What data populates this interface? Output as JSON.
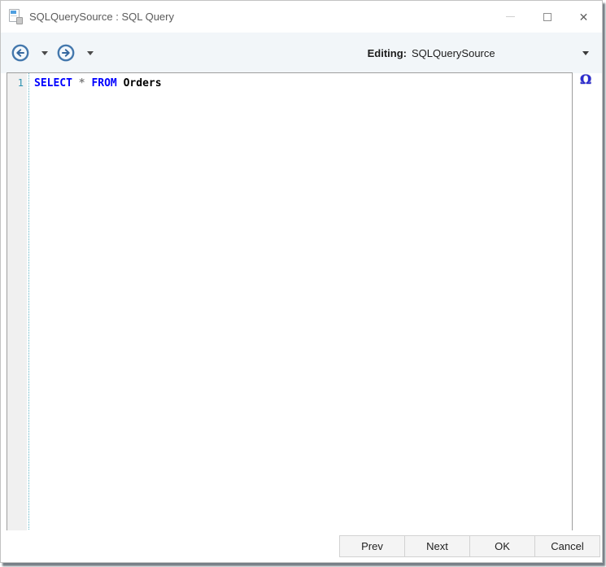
{
  "window": {
    "title": "SQLQuerySource : SQL Query",
    "controls": {
      "close_glyph": "✕"
    }
  },
  "toolbar": {
    "editing_label": "Editing:",
    "editing_value": "SQLQuerySource"
  },
  "editor": {
    "lines": [
      {
        "number": "1",
        "tokens": [
          {
            "text": "SELECT",
            "type": "keyword"
          },
          {
            "text": " ",
            "type": "plain"
          },
          {
            "text": "*",
            "type": "operator"
          },
          {
            "text": " ",
            "type": "plain"
          },
          {
            "text": "FROM",
            "type": "keyword"
          },
          {
            "text": " Orders",
            "type": "plain"
          }
        ]
      }
    ],
    "symbol_glyph": "Ω"
  },
  "footer": {
    "buttons": [
      {
        "label": "Prev"
      },
      {
        "label": "Next"
      },
      {
        "label": "OK"
      },
      {
        "label": "Cancel"
      }
    ]
  },
  "icons": {
    "document": "document-icon",
    "back": "back-arrow-circle-icon",
    "forward": "forward-arrow-circle-icon",
    "dropdown": "chevron-down-icon",
    "minimize": "minimize-icon",
    "maximize": "maximize-icon",
    "close": "close-icon",
    "omega": "omega-symbol-icon"
  },
  "colors": {
    "keyword": "#0000ff",
    "operator": "#808080",
    "plain": "#000000",
    "line_number": "#2b91af",
    "accent_blue": "#3c78b4",
    "toolbar_bg": "#f2f6f9",
    "omega": "#2a2ad2"
  }
}
